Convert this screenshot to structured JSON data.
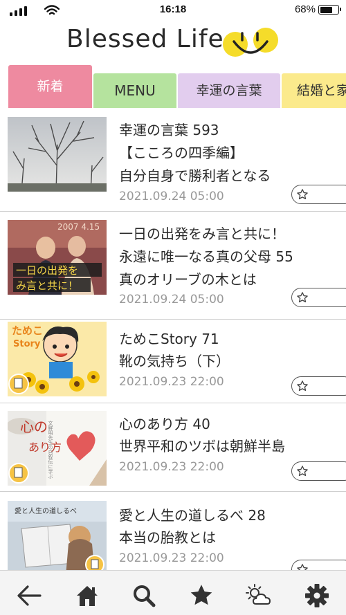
{
  "status_bar": {
    "time": "16:18",
    "battery": "68%",
    "battery_level": 0.68
  },
  "header": {
    "logo_text": "Blessed Life",
    "logo_icon": "smile-face-icon"
  },
  "tabs": [
    {
      "label": "新着",
      "active": true,
      "color": "#ee8aa0"
    },
    {
      "label": "MENU",
      "active": false,
      "color": "#b5e39e"
    },
    {
      "label": "幸運の言葉",
      "active": false,
      "color": "#e2cdee"
    },
    {
      "label": "結婚と家",
      "active": false,
      "color": "#fbea8c"
    }
  ],
  "articles": [
    {
      "title_lines": [
        "幸運の言葉 593",
        "【こころの四季編】",
        "自分自身で勝利者となる"
      ],
      "date": "2021.09.24 05:00",
      "thumb_icon": "bare-tree-photo"
    },
    {
      "title_lines": [
        "一日の出発をみ言と共に！",
        "永遠に唯一なる真の父母 55",
        "真のオリーブの木とは"
      ],
      "date": "2021.09.24 05:00",
      "thumb_icon": "couple-photo",
      "thumb_text": [
        "一日の出発を",
        "み言と共に！"
      ],
      "thumb_year": "2007 4.15"
    },
    {
      "title_lines": [
        "ためこStory 71",
        "靴の気持ち（下）"
      ],
      "date": "2021.09.23 22:00",
      "thumb_icon": "cartoon-illustration",
      "thumb_text": [
        "ためこ",
        "Story"
      ]
    },
    {
      "title_lines": [
        "心のあり方 40",
        "世界平和のツボは朝鮮半島"
      ],
      "date": "2021.09.23 22:00",
      "thumb_icon": "heart-drawing-photo",
      "thumb_text": [
        "心の",
        "あり方"
      ],
      "thumb_sub": "文鮮明先生の自叙伝に学ぶ"
    },
    {
      "title_lines": [
        "愛と人生の道しるべ 28",
        "本当の胎教とは"
      ],
      "date": "2021.09.23 22:00",
      "thumb_icon": "reading-child-photo",
      "thumb_text": [
        "愛と人生の道しるべ"
      ]
    }
  ],
  "toolbar": {
    "items": [
      "back-arrow-icon",
      "home-icon",
      "search-icon",
      "star-icon",
      "weather-icon",
      "gear-icon"
    ]
  },
  "colors": {
    "accent_pink": "#ee8aa0",
    "menu_green": "#b5e39e",
    "kotoba_purple": "#e2cdee",
    "kekkon_yellow": "#fbea8c",
    "smile_yellow": "#f5dc2a"
  }
}
